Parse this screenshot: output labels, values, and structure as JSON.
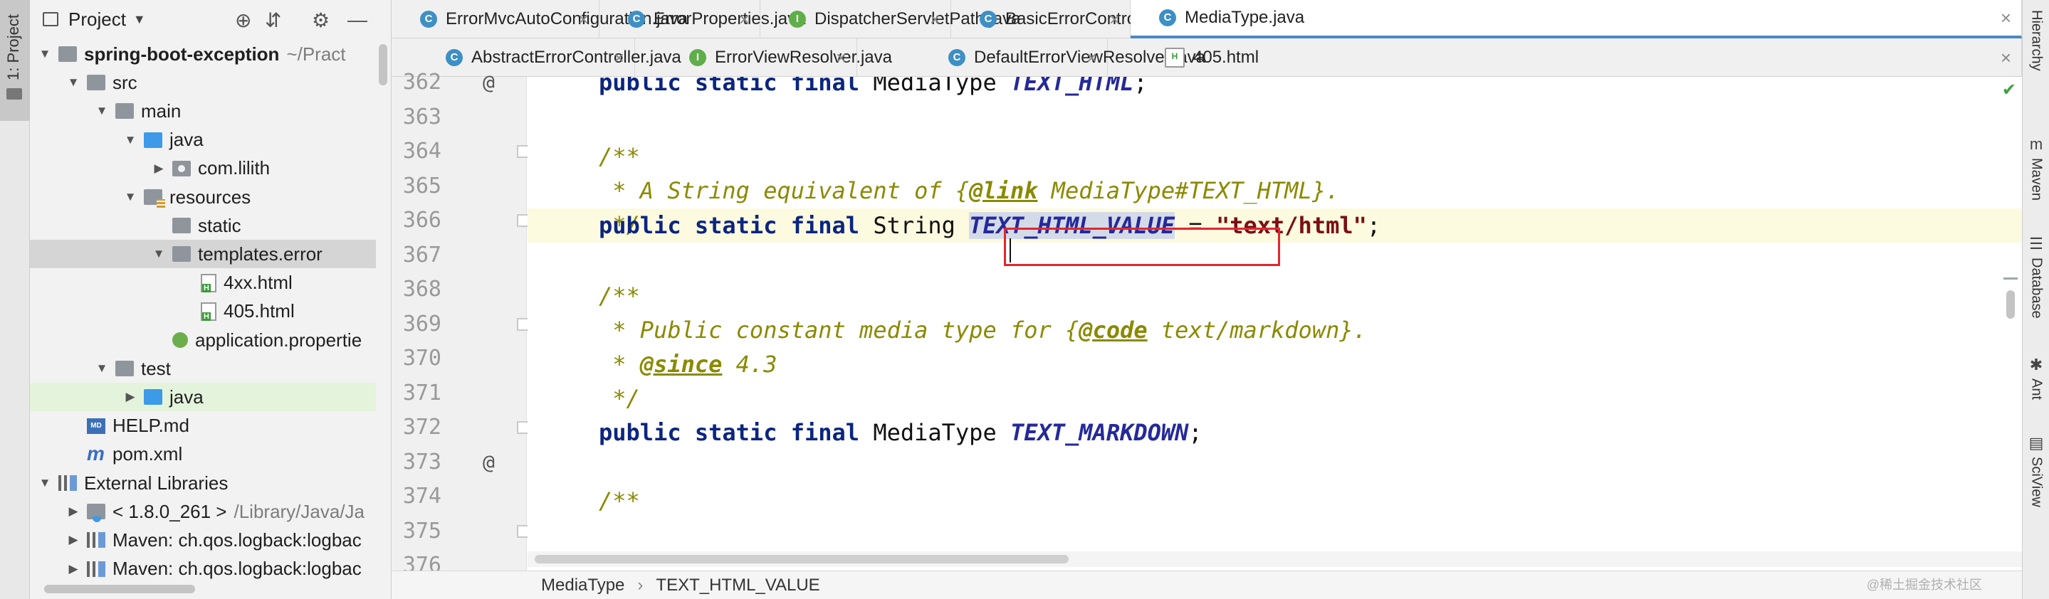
{
  "left_strip": {
    "project_tab": "1: Project"
  },
  "project_panel": {
    "title": "Project",
    "tree": [
      {
        "label": "spring-boot-exception",
        "hint": "~/Pract",
        "bold": true,
        "indent": 0,
        "twisty": "open",
        "icon": "folder-gray"
      },
      {
        "label": "src",
        "indent": 1,
        "twisty": "open",
        "icon": "folder-gray"
      },
      {
        "label": "main",
        "indent": 2,
        "twisty": "open",
        "icon": "folder-gray"
      },
      {
        "label": "java",
        "indent": 3,
        "twisty": "open",
        "icon": "folder-blue"
      },
      {
        "label": "com.lilith",
        "indent": 4,
        "twisty": "closed",
        "icon": "folder-pkg"
      },
      {
        "label": "resources",
        "indent": 3,
        "twisty": "open",
        "icon": "folder-res"
      },
      {
        "label": "static",
        "indent": 4,
        "twisty": "",
        "icon": "folder-gray"
      },
      {
        "label": "templates.error",
        "indent": 4,
        "twisty": "open",
        "icon": "folder-gray",
        "state": "sel"
      },
      {
        "label": "4xx.html",
        "indent": 5,
        "twisty": "",
        "icon": "file-html"
      },
      {
        "label": "405.html",
        "indent": 5,
        "twisty": "",
        "icon": "file-html"
      },
      {
        "label": "application.propertie",
        "indent": 4,
        "twisty": "",
        "icon": "file-props"
      },
      {
        "label": "test",
        "indent": 2,
        "twisty": "open",
        "icon": "folder-gray"
      },
      {
        "label": "java",
        "indent": 3,
        "twisty": "closed",
        "icon": "folder-blue",
        "state": "hl"
      },
      {
        "label": "HELP.md",
        "indent": 1,
        "twisty": "",
        "icon": "file-md"
      },
      {
        "label": "pom.xml",
        "indent": 1,
        "twisty": "",
        "icon": "file-maven"
      },
      {
        "label": "External Libraries",
        "indent": 0,
        "twisty": "open",
        "icon": "lib"
      },
      {
        "label": "< 1.8.0_261 >",
        "hint": "/Library/Java/Ja",
        "indent": 1,
        "twisty": "closed",
        "icon": "jdk"
      },
      {
        "label": "Maven: ch.qos.logback:logbac",
        "indent": 1,
        "twisty": "closed",
        "icon": "lib"
      },
      {
        "label": "Maven: ch.qos.logback:logbac",
        "indent": 1,
        "twisty": "closed",
        "icon": "lib"
      }
    ]
  },
  "tabs_row1": [
    {
      "label": "ErrorMvcAutoConfiguration.java",
      "kind": "c"
    },
    {
      "label": "ErrorProperties.java",
      "kind": "c"
    },
    {
      "label": "DispatcherServletPath.java",
      "kind": "i"
    },
    {
      "label": "BasicErrorController.java",
      "kind": "c"
    },
    {
      "label": "MediaType.java",
      "kind": "c",
      "active": true
    }
  ],
  "tabs_row2": [
    {
      "label": "AbstractErrorController.java",
      "kind": "c"
    },
    {
      "label": "ErrorViewResolver.java",
      "kind": "i"
    },
    {
      "label": "DefaultErrorViewResolver.java",
      "kind": "c"
    },
    {
      "label": "405.html",
      "kind": "h"
    }
  ],
  "editor": {
    "line_numbers": [
      "362",
      "363",
      "364",
      "365",
      "366",
      "367",
      "368",
      "369",
      "370",
      "371",
      "372",
      "373",
      "374",
      "375",
      "376"
    ],
    "code": {
      "l362_kw": "public static final ",
      "l362_type": "MediaType ",
      "l362_field": "TEXT_HTML",
      "l362_end": ";",
      "l364": "/**",
      "l365_a": " * A String equivalent of {",
      "l365_tag": "@link",
      "l365_b": " MediaType#TEXT_HTML}.",
      "l366": " */",
      "l367_kw": "public static final ",
      "l367_type": "String ",
      "l367_field": "TEXT_HTML_VALUE",
      "l367_eq": " = ",
      "l367_str": "\"text/html\"",
      "l367_end": ";",
      "l369": "/**",
      "l370_a": " * Public constant media type for {",
      "l370_tag": "@code",
      "l370_b": " text/markdown}.",
      "l371_a": " * ",
      "l371_tag": "@since",
      "l371_b": " 4.3",
      "l372": " */",
      "l373_kw": "public static final ",
      "l373_type": "MediaType ",
      "l373_field": "TEXT_MARKDOWN",
      "l373_end": ";",
      "l375": "/**"
    },
    "override_markers": [
      "@",
      "@"
    ]
  },
  "breadcrumb": {
    "items": [
      "MediaType",
      "TEXT_HTML_VALUE"
    ]
  },
  "watermark": "@稀土掘金技术社区",
  "right_strip": [
    "Hierarchy",
    "Maven",
    "Database",
    "Ant",
    "SciView"
  ],
  "colors": {
    "accent": "#4a88c7",
    "highlight_box": "#e2262f",
    "keyword": "#0b2580",
    "javadoc": "#8a8a00"
  }
}
